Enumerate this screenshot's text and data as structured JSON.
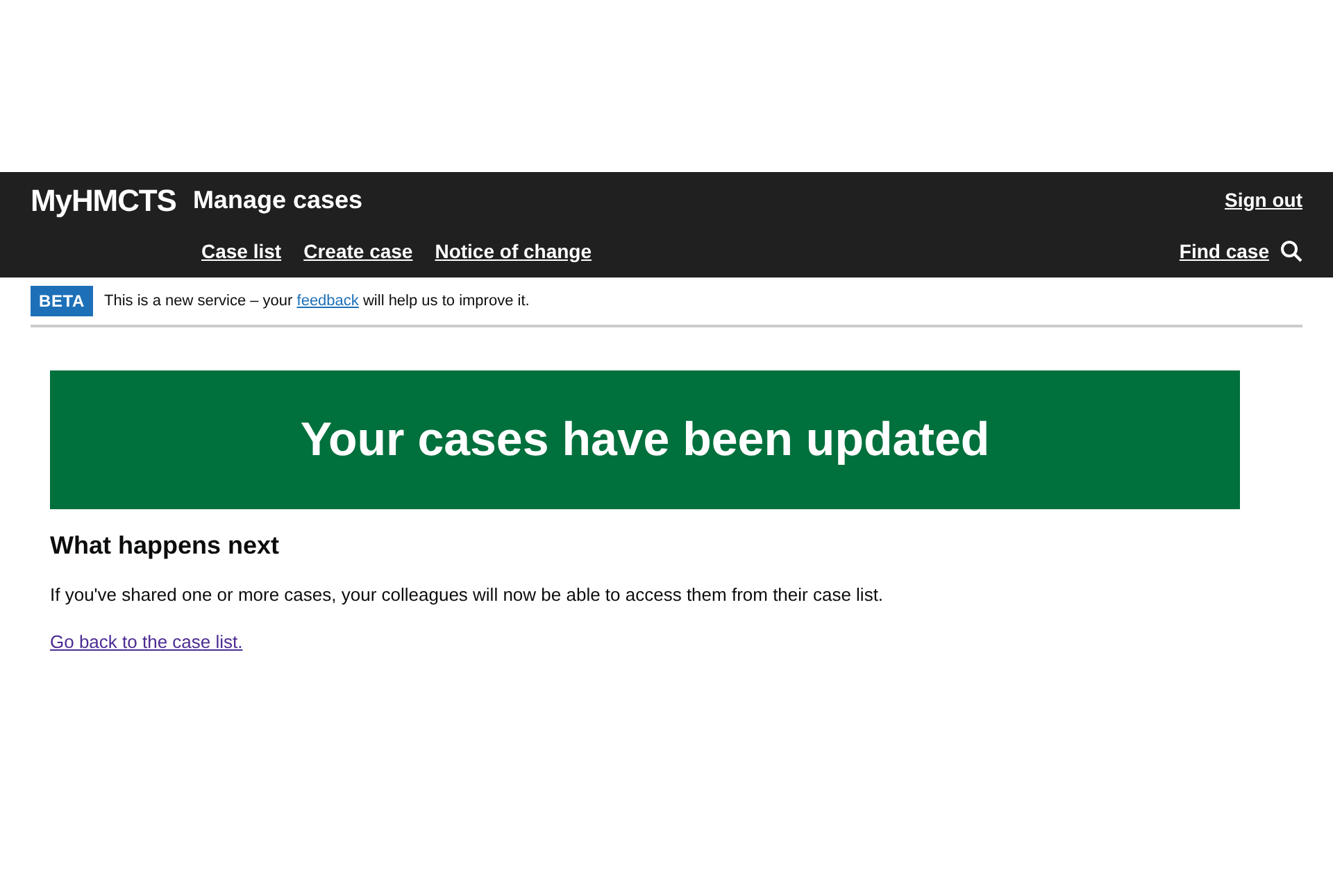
{
  "header": {
    "logo": "MyHMCTS",
    "service": "Manage cases",
    "sign_out": "Sign out",
    "nav": [
      {
        "label": "Case list"
      },
      {
        "label": "Create case"
      },
      {
        "label": "Notice of change"
      }
    ],
    "find_case": "Find case"
  },
  "phase_banner": {
    "tag": "BETA",
    "text_before": "This is a new service – your",
    "link": "feedback",
    "text_after": "will help us to improve it."
  },
  "panel": {
    "title": "Your cases have been updated"
  },
  "content": {
    "heading": "What happens next",
    "body": "If you've shared one or more cases, your colleagues will now be able to access them from their case list.",
    "link": "Go back to the case list."
  }
}
